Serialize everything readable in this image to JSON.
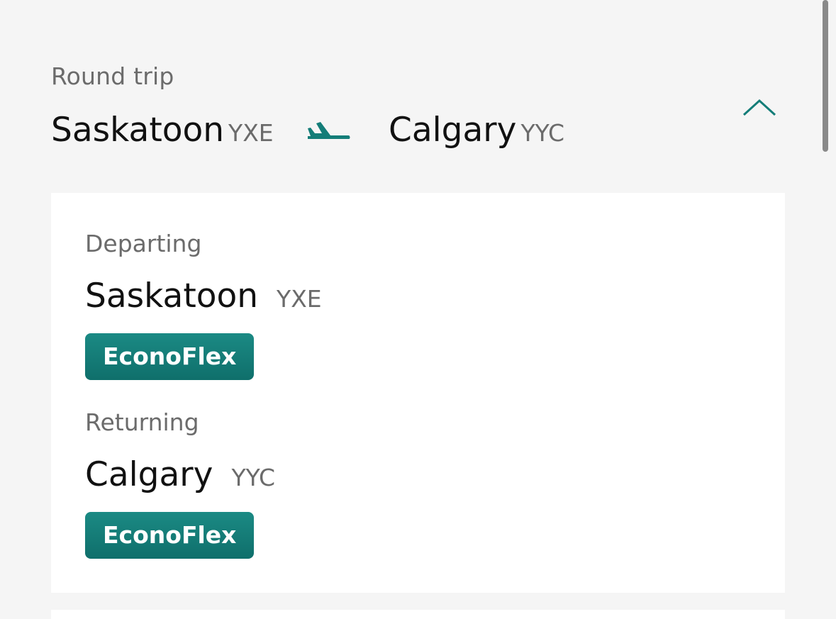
{
  "trip": {
    "type": "Round trip",
    "origin": {
      "city": "Saskatoon",
      "code": "YXE"
    },
    "destination": {
      "city": "Calgary",
      "code": "YYC"
    }
  },
  "icons": {
    "plane": "plane-icon",
    "collapse": "chevron-up-icon"
  },
  "colors": {
    "accent": "#137d78",
    "muted_text": "#6b6b6b",
    "background": "#f5f5f5",
    "card": "#ffffff"
  },
  "details": {
    "departing": {
      "label": "Departing",
      "city": "Saskatoon",
      "code": "YXE",
      "fare": "EconoFlex"
    },
    "returning": {
      "label": "Returning",
      "city": "Calgary",
      "code": "YYC",
      "fare": "EconoFlex"
    }
  }
}
